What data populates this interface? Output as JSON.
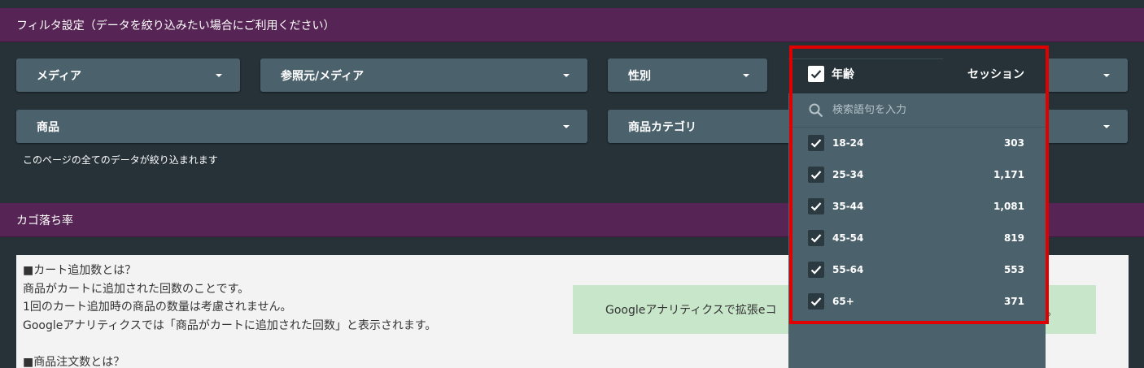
{
  "filter_section": {
    "title": "フィルタ設定（データを絞り込みたい場合にご利用ください）"
  },
  "filters": {
    "media": "メディア",
    "referrer_media": "参照元/メディア",
    "gender": "性別",
    "product": "商品",
    "product_category": "商品カテゴリ"
  },
  "note": "このページの全てのデータが絞り込まれます",
  "cart_section": {
    "title": "カゴ落ち率"
  },
  "content": {
    "lines": [
      "■カート追加数とは？",
      "商品がカートに追加された回数のことです。",
      "1回のカート追加時の商品の数量は考慮されません。",
      "Googleアナリティクスでは「商品がカートに追加された回数」と表示されます。",
      "",
      "■商品注文数とは？"
    ],
    "green_text": "Googleアナリティクスで拡張eコ",
    "green_tail": "。"
  },
  "dropdown": {
    "header_label": "年齢",
    "header_metric": "セッション",
    "search_placeholder": "検索語句を入力",
    "options": [
      {
        "label": "18-24",
        "count": "303"
      },
      {
        "label": "25-34",
        "count": "1,171"
      },
      {
        "label": "35-44",
        "count": "1,081"
      },
      {
        "label": "45-54",
        "count": "819"
      },
      {
        "label": "55-64",
        "count": "553"
      },
      {
        "label": "65+",
        "count": "371"
      }
    ]
  },
  "colors": {
    "background": "#263238",
    "section_header": "#572555",
    "control": "#4b626d",
    "highlight": "#e00000",
    "green_box": "#c8e6c9"
  }
}
